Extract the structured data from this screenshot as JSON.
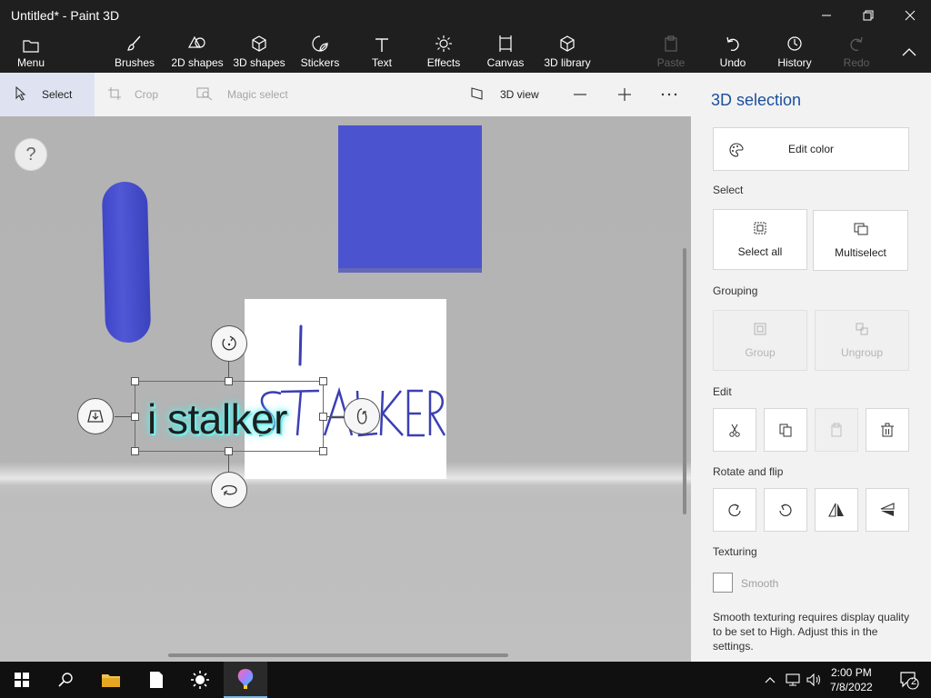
{
  "window": {
    "title": "Untitled* - Paint 3D"
  },
  "ribbon": {
    "menu": "Menu",
    "brushes": "Brushes",
    "shapes_2d": "2D shapes",
    "shapes_3d": "3D shapes",
    "stickers": "Stickers",
    "text": "Text",
    "effects": "Effects",
    "canvas": "Canvas",
    "library_3d": "3D library",
    "paste": "Paste",
    "undo": "Undo",
    "history": "History",
    "redo": "Redo"
  },
  "toolbar": {
    "select": "Select",
    "crop": "Crop",
    "magic_select": "Magic select",
    "view_3d": "3D view"
  },
  "canvas": {
    "help": "?",
    "text_object": "i stalker",
    "drawing_line1": "I",
    "drawing_line2": "STALKER"
  },
  "panel": {
    "title": "3D selection",
    "edit_color": "Edit color",
    "select_label": "Select",
    "select_all": "Select all",
    "multiselect": "Multiselect",
    "grouping_label": "Grouping",
    "group": "Group",
    "ungroup": "Ungroup",
    "edit_label": "Edit",
    "rotate_flip_label": "Rotate and flip",
    "texturing_label": "Texturing",
    "smooth": "Smooth",
    "smooth_note": "Smooth texturing requires display quality to be set to High. Adjust this in the settings."
  },
  "taskbar": {
    "time": "2:00 PM",
    "date": "7/8/2022",
    "notification_count": "2"
  },
  "colors": {
    "accent": "#1a4f9c",
    "shape_blue": "#4b53cf",
    "ink_blue": "#3b3fb3",
    "glow_cyan": "#6ff2ef"
  }
}
